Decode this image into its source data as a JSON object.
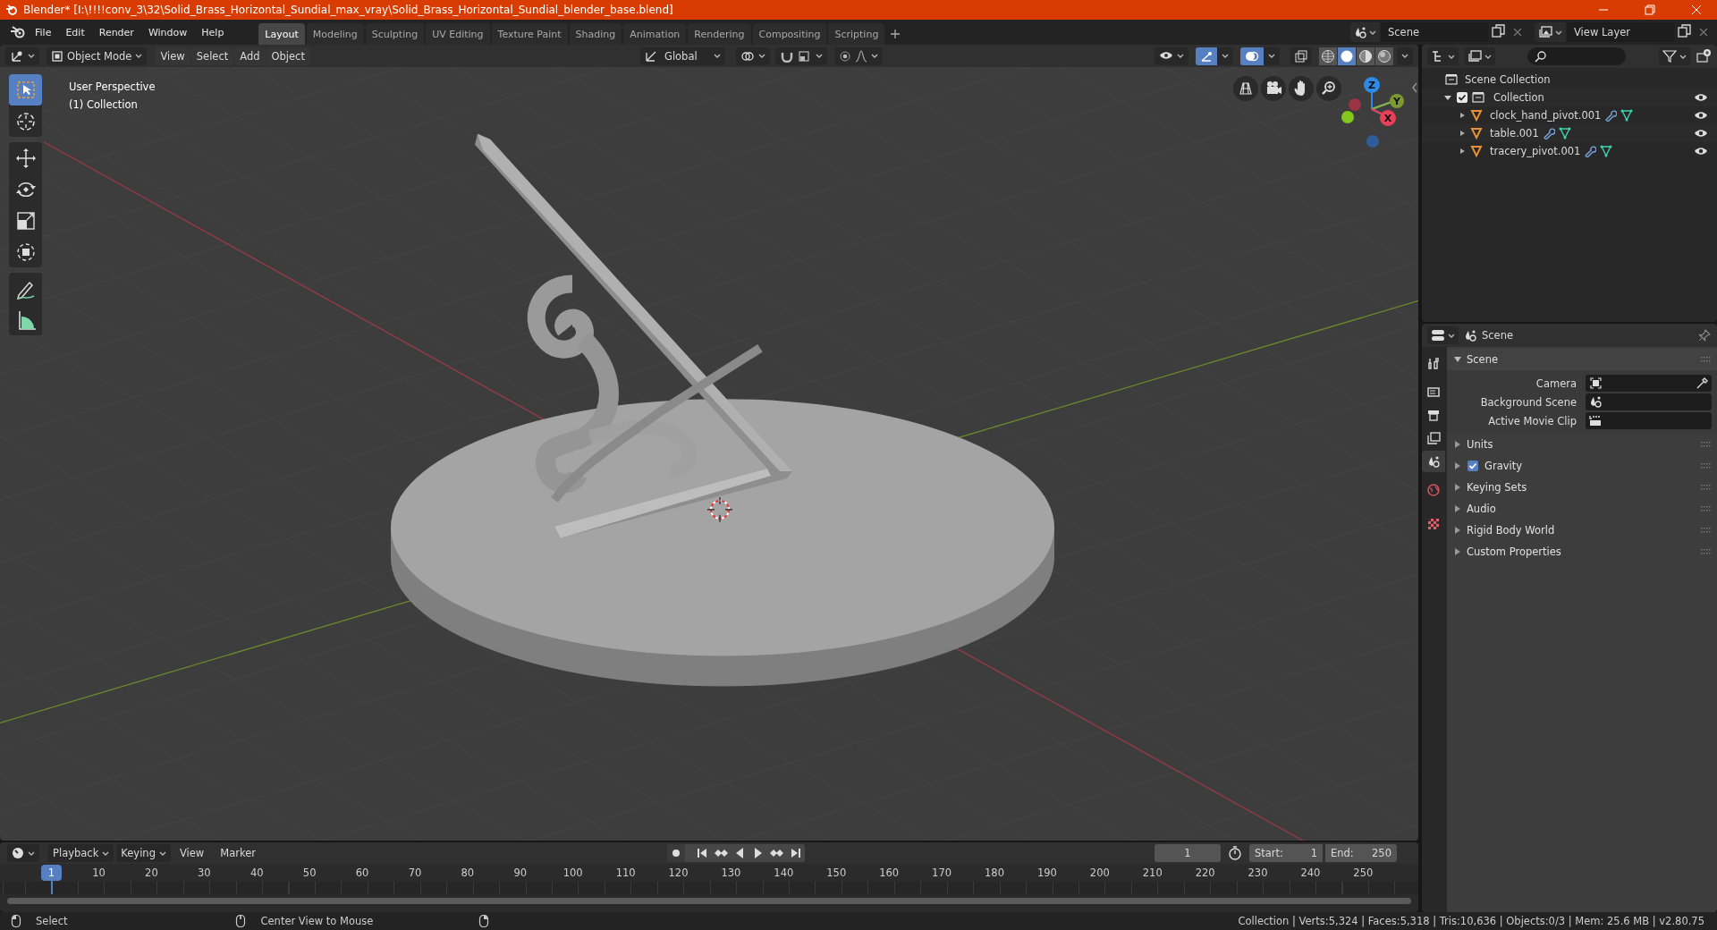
{
  "window": {
    "title": "Blender* [I:\\!!!!conv_3\\32\\Solid_Brass_Horizontal_Sundial_max_vray\\Solid_Brass_Horizontal_Sundial_blender_base.blend]"
  },
  "menu": [
    "File",
    "Edit",
    "Render",
    "Window",
    "Help"
  ],
  "workspaces": [
    {
      "label": "Layout",
      "selected": true
    },
    {
      "label": "Modeling",
      "selected": false
    },
    {
      "label": "Sculpting",
      "selected": false
    },
    {
      "label": "UV Editing",
      "selected": false
    },
    {
      "label": "Texture Paint",
      "selected": false
    },
    {
      "label": "Shading",
      "selected": false
    },
    {
      "label": "Animation",
      "selected": false
    },
    {
      "label": "Rendering",
      "selected": false
    },
    {
      "label": "Compositing",
      "selected": false
    },
    {
      "label": "Scripting",
      "selected": false
    }
  ],
  "scene": {
    "label": "Scene"
  },
  "view_layer": {
    "label": "View Layer"
  },
  "viewport": {
    "mode": "Object Mode",
    "menus": [
      "View",
      "Select",
      "Add",
      "Object"
    ],
    "orientation": "Global",
    "shading": [
      {
        "kind": "wireframe",
        "selected": false
      },
      {
        "kind": "solid",
        "selected": true
      },
      {
        "kind": "material",
        "selected": false
      },
      {
        "kind": "rendered",
        "selected": false
      }
    ],
    "view_name": "User Perspective",
    "collection": "(1) Collection",
    "tools": [
      {
        "kind": "select",
        "selected": true
      },
      {
        "kind": "cursor",
        "selected": false
      },
      {
        "kind": "move",
        "selected": false
      },
      {
        "kind": "rotate",
        "selected": false
      },
      {
        "kind": "scale",
        "selected": false
      },
      {
        "kind": "transform",
        "selected": false
      },
      {
        "kind": "annotate",
        "selected": false
      },
      {
        "kind": "measure",
        "selected": false
      }
    ],
    "gizmo": {
      "axes": [
        "Z",
        "Y",
        "X"
      ]
    }
  },
  "outliner": {
    "root": "Scene Collection",
    "collections": [
      {
        "name": "Collection",
        "checked": true,
        "expanded": true,
        "children": [
          {
            "name": "clock_hand_pivot.001",
            "expanded": false
          },
          {
            "name": "table.001",
            "expanded": false
          },
          {
            "name": "tracery_pivot.001",
            "expanded": false
          }
        ]
      }
    ]
  },
  "properties": {
    "context": "Scene",
    "tabs": [
      {
        "kind": "tool",
        "selected": false
      },
      {
        "kind": "render",
        "selected": false
      },
      {
        "kind": "output",
        "selected": false
      },
      {
        "kind": "view_layer",
        "selected": false
      },
      {
        "kind": "scene",
        "selected": true
      },
      {
        "kind": "world",
        "selected": false
      },
      {
        "kind": "texture",
        "selected": false
      }
    ],
    "panels": [
      {
        "title": "Scene",
        "expanded": true,
        "fields": [
          {
            "label": "Camera",
            "kind": "camera"
          },
          {
            "label": "Background Scene",
            "kind": "scene"
          },
          {
            "label": "Active Movie Clip",
            "kind": "clip"
          }
        ]
      },
      {
        "title": "Units",
        "expanded": false
      },
      {
        "title": "Gravity",
        "expanded": false,
        "checked": true
      },
      {
        "title": "Keying Sets",
        "expanded": false
      },
      {
        "title": "Audio",
        "expanded": false
      },
      {
        "title": "Rigid Body World",
        "expanded": false
      },
      {
        "title": "Custom Properties",
        "expanded": false
      }
    ]
  },
  "timeline": {
    "menus": [
      {
        "label": "Playback",
        "kind": "dropdown"
      },
      {
        "label": "Keying",
        "kind": "dropdown"
      },
      {
        "label": "View",
        "kind": "menu"
      },
      {
        "label": "Marker",
        "kind": "menu"
      }
    ],
    "current_frame": "1",
    "playhead": "1",
    "start_label": "Start:",
    "start": "1",
    "end_label": "End:",
    "end": "250",
    "ticks": [
      "10",
      "20",
      "30",
      "40",
      "50",
      "60",
      "70",
      "80",
      "90",
      "100",
      "110",
      "120",
      "130",
      "140",
      "150",
      "160",
      "170",
      "180",
      "190",
      "200",
      "210",
      "220",
      "230",
      "240",
      "250"
    ]
  },
  "status_bar": {
    "hints": [
      "Select",
      "Center View to Mouse"
    ],
    "stats": "Collection | Verts:5,324 | Faces:5,318 | Tris:10,636 | Objects:0/3 | Mem: 25.6 MB | v2.80.75"
  }
}
